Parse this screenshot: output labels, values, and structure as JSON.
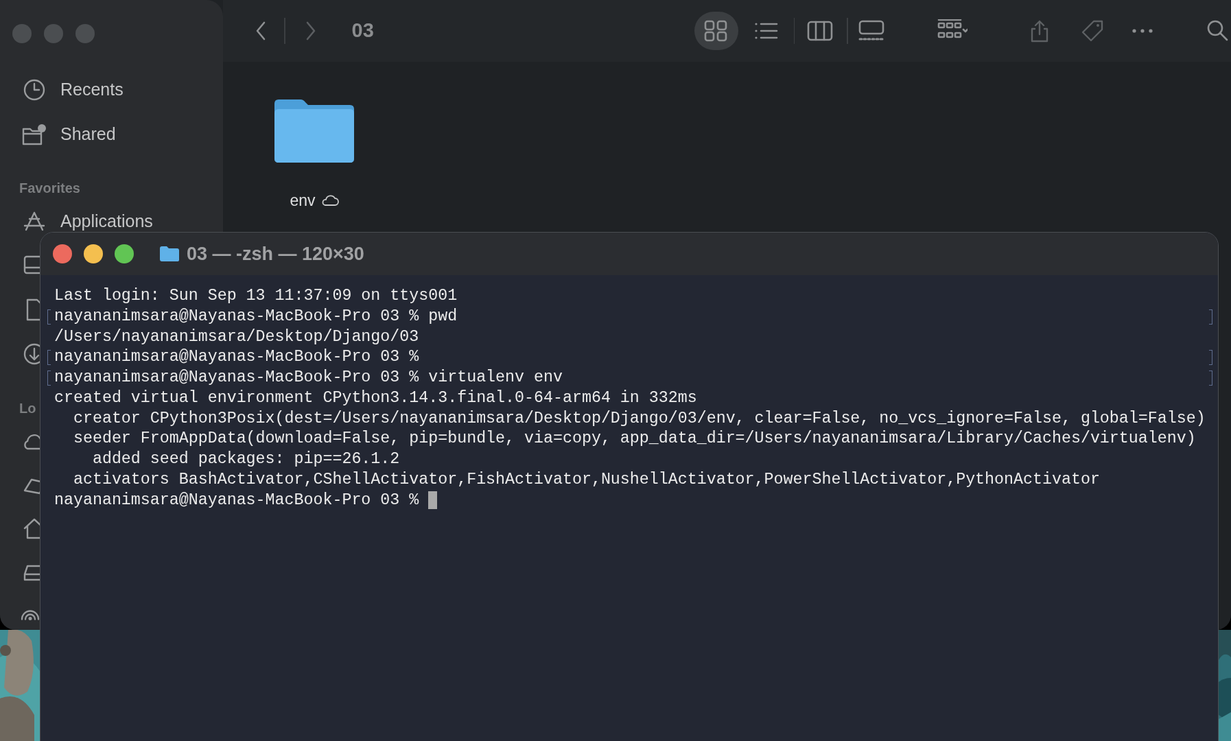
{
  "finder": {
    "title": "03",
    "views": [
      {
        "kind": "icons",
        "selected": true
      },
      {
        "kind": "list",
        "selected": false
      },
      {
        "kind": "columns",
        "selected": false
      },
      {
        "kind": "gallery",
        "selected": false
      }
    ],
    "sidebar": {
      "items": [
        {
          "label": "Recents"
        },
        {
          "label": "Shared"
        }
      ],
      "favorites": {
        "header": "Favorites",
        "items": [
          {
            "label": "Applications"
          }
        ]
      },
      "locations": {
        "header": "Lo"
      }
    },
    "files": [
      {
        "name": "env",
        "in_cloud": true
      }
    ]
  },
  "terminal": {
    "title": "03 — -zsh — 120×30",
    "lines": [
      {
        "text": "Last login: Sun Sep 13 11:37:09 on ttys001",
        "marked": false,
        "cursor": false
      },
      {
        "text": "nayananimsara@Nayanas-MacBook-Pro 03 % pwd",
        "marked": true,
        "cursor": false
      },
      {
        "text": "/Users/nayananimsara/Desktop/Django/03",
        "marked": false,
        "cursor": false
      },
      {
        "text": "nayananimsara@Nayanas-MacBook-Pro 03 %",
        "marked": true,
        "cursor": false
      },
      {
        "text": "nayananimsara@Nayanas-MacBook-Pro 03 % virtualenv env",
        "marked": true,
        "cursor": false
      },
      {
        "text": "created virtual environment CPython3.14.3.final.0-64-arm64 in 332ms",
        "marked": false,
        "cursor": false
      },
      {
        "text": "  creator CPython3Posix(dest=/Users/nayananimsara/Desktop/Django/03/env, clear=False, no_vcs_ignore=False, global=False)",
        "marked": false,
        "cursor": false
      },
      {
        "text": "  seeder FromAppData(download=False, pip=bundle, via=copy, app_data_dir=/Users/nayananimsara/Library/Caches/virtualenv)",
        "marked": false,
        "cursor": false
      },
      {
        "text": "    added seed packages: pip==26.1.2",
        "marked": false,
        "cursor": false
      },
      {
        "text": "  activators BashActivator,CShellActivator,FishActivator,NushellActivator,PowerShellActivator,PythonActivator",
        "marked": false,
        "cursor": false
      },
      {
        "text": "nayananimsara@Nayanas-MacBook-Pro 03 %",
        "marked": false,
        "cursor": true
      }
    ]
  }
}
